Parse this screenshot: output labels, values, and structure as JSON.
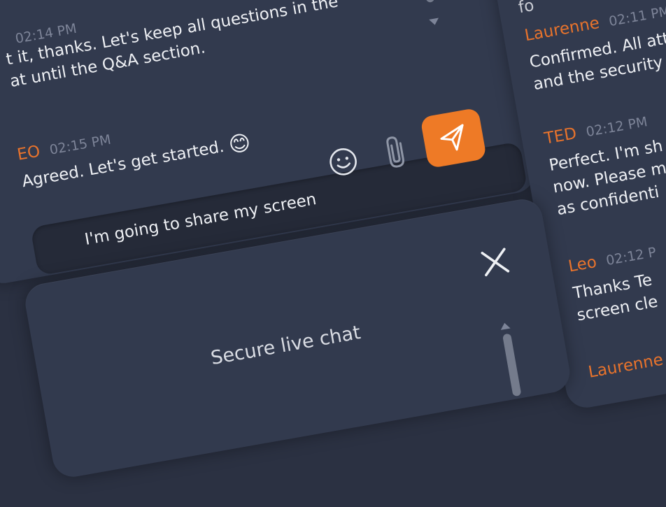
{
  "left_chat": {
    "messages": [
      {
        "time": "02:14 PM",
        "lines": [
          "t it, thanks. Let's keep all questions in the",
          "at until the Q&A section."
        ]
      },
      {
        "author": "EO",
        "time": "02:15 PM",
        "lines": [
          "Agreed. Let's get started."
        ],
        "emoji": "😊"
      }
    ],
    "composer": {
      "value": "I'm going to share my screen"
    }
  },
  "right_chat": {
    "top_fragment": "fo",
    "messages": [
      {
        "author": "Laurenne",
        "time": "02:11 PM",
        "lines": [
          "Confirmed. All att",
          "and the security"
        ]
      },
      {
        "author": "TED",
        "time": "02:12 PM",
        "lines": [
          "Perfect. I'm sh",
          "now. Please m",
          "as confidenti"
        ]
      },
      {
        "author": "Leo",
        "time": "02:12 P",
        "lines": [
          "Thanks Te",
          "screen cle"
        ]
      },
      {
        "author": "Laurenne"
      }
    ]
  },
  "bottom_panel": {
    "title": "Secure live chat"
  },
  "icons": {
    "emoji": "smiley-icon",
    "attach": "paperclip-icon",
    "send": "send-icon",
    "close": "close-icon"
  },
  "colors": {
    "background": "#2b3142",
    "panel": "#323a4e",
    "input": "#252a38",
    "accent": "#ee7a26",
    "author": "#e8732c",
    "timestamp": "#7d8498",
    "text": "#eef0f4"
  }
}
